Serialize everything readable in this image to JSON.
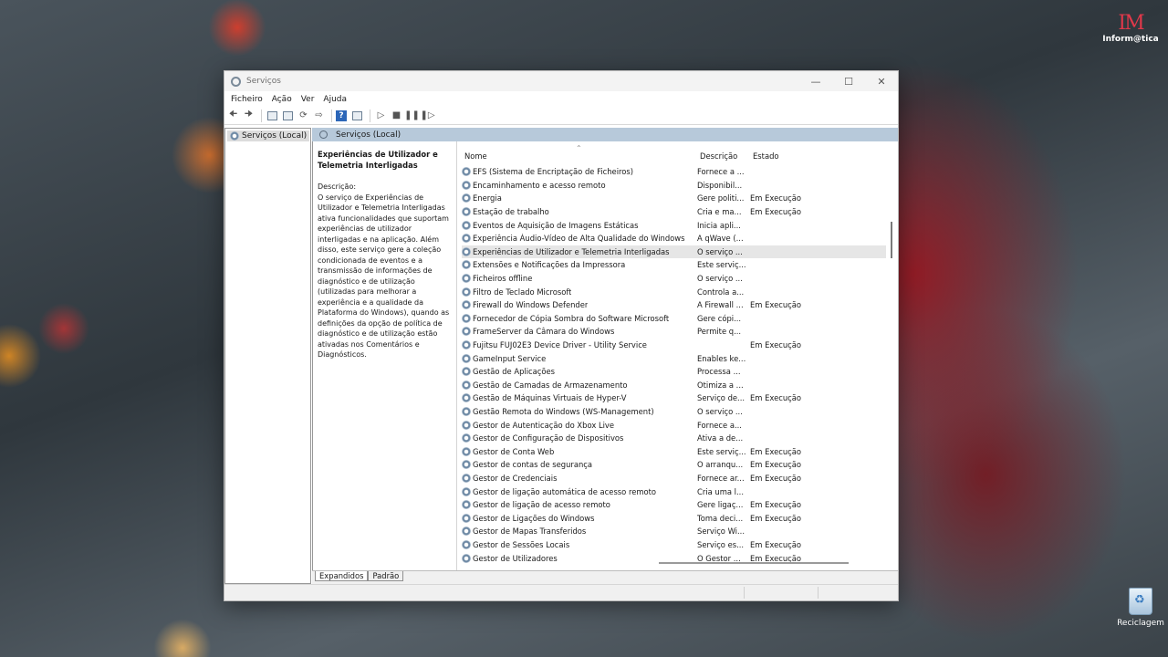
{
  "desktop": {
    "logo_mark": "IM",
    "logo_text": "Inform@tica",
    "recycle_label": "Reciclagem"
  },
  "window": {
    "title": "Serviços",
    "controls": [
      "—",
      "☐",
      "✕"
    ]
  },
  "menu": [
    "Ficheiro",
    "Ação",
    "Ver",
    "Ajuda"
  ],
  "tree": {
    "item": "Serviços (Local)"
  },
  "panel": {
    "header": "Serviços (Local)"
  },
  "details": {
    "title": "Experiências de Utilizador e Telemetria Interligadas",
    "desc_label": "Descrição:",
    "desc_text": "O serviço de Experiências de Utilizador e Telemetria Interligadas ativa funcionalidades que suportam experiências de utilizador interligadas e na aplicação. Além disso, este serviço gere a coleção condicionada de eventos e a transmissão de informações de diagnóstico e de utilização (utilizadas para melhorar a experiência e a qualidade da Plataforma do Windows), quando as definições da opção de política de diagnóstico e de utilização estão ativadas nos Comentários e Diagnósticos."
  },
  "columns": {
    "name": "Nome",
    "desc": "Descrição",
    "state": "Estado"
  },
  "services": [
    {
      "name": "EFS (Sistema de Encriptação de Ficheiros)",
      "desc": "Fornece a ...",
      "state": ""
    },
    {
      "name": "Encaminhamento e acesso remoto",
      "desc": "Disponibil...",
      "state": ""
    },
    {
      "name": "Energia",
      "desc": "Gere politi...",
      "state": "Em Execução"
    },
    {
      "name": "Estação de trabalho",
      "desc": "Cria e ma...",
      "state": "Em Execução"
    },
    {
      "name": "Eventos de Aquisição de Imagens Estáticas",
      "desc": "Inicia apli...",
      "state": ""
    },
    {
      "name": "Experiência Áudio-Vídeo de Alta Qualidade do Windows",
      "desc": "A qWave (...",
      "state": ""
    },
    {
      "name": "Experiências de Utilizador e Telemetria Interligadas",
      "desc": "O serviço ...",
      "state": ""
    },
    {
      "name": "Extensões e Notificações da Impressora",
      "desc": "Este serviç...",
      "state": ""
    },
    {
      "name": "Ficheiros offline",
      "desc": "O serviço ...",
      "state": ""
    },
    {
      "name": "Filtro de Teclado Microsoft",
      "desc": "Controla a...",
      "state": ""
    },
    {
      "name": "Firewall do Windows Defender",
      "desc": "A Firewall ...",
      "state": "Em Execução"
    },
    {
      "name": "Fornecedor de Cópia Sombra do Software Microsoft",
      "desc": "Gere cópi...",
      "state": ""
    },
    {
      "name": "FrameServer da Câmara do Windows",
      "desc": "Permite q...",
      "state": ""
    },
    {
      "name": "Fujitsu FUJ02E3 Device Driver - Utility Service",
      "desc": "",
      "state": "Em Execução"
    },
    {
      "name": "GameInput Service",
      "desc": "Enables ke...",
      "state": ""
    },
    {
      "name": "Gestão de Aplicações",
      "desc": "Processa ...",
      "state": ""
    },
    {
      "name": "Gestão de Camadas de Armazenamento",
      "desc": "Otimiza a ...",
      "state": ""
    },
    {
      "name": "Gestão de Máquinas Virtuais de Hyper-V",
      "desc": "Serviço de...",
      "state": "Em Execução"
    },
    {
      "name": "Gestão Remota do Windows (WS-Management)",
      "desc": "O serviço ...",
      "state": ""
    },
    {
      "name": "Gestor de Autenticação do Xbox Live",
      "desc": "Fornece a...",
      "state": ""
    },
    {
      "name": "Gestor de Configuração de Dispositivos",
      "desc": "Ativa a de...",
      "state": ""
    },
    {
      "name": "Gestor de Conta Web",
      "desc": "Este serviç...",
      "state": "Em Execução"
    },
    {
      "name": "Gestor de contas de segurança",
      "desc": "O arranqu...",
      "state": "Em Execução"
    },
    {
      "name": "Gestor de Credenciais",
      "desc": "Fornece ar...",
      "state": "Em Execução"
    },
    {
      "name": "Gestor de ligação automática de acesso remoto",
      "desc": "Cria uma l...",
      "state": ""
    },
    {
      "name": "Gestor de ligação de acesso remoto",
      "desc": "Gere ligaç...",
      "state": "Em Execução"
    },
    {
      "name": "Gestor de Ligações do Windows",
      "desc": "Toma deci...",
      "state": "Em Execução"
    },
    {
      "name": "Gestor de Mapas Transferidos",
      "desc": "Serviço Wi...",
      "state": ""
    },
    {
      "name": "Gestor de Sessões Locais",
      "desc": "Serviço es...",
      "state": "Em Execução"
    },
    {
      "name": "Gestor de Utilizadores",
      "desc": "O Gestor ...",
      "state": "Em Execução"
    }
  ],
  "selected_index": 6,
  "tabs": [
    "Expandidos",
    "Padrão"
  ]
}
